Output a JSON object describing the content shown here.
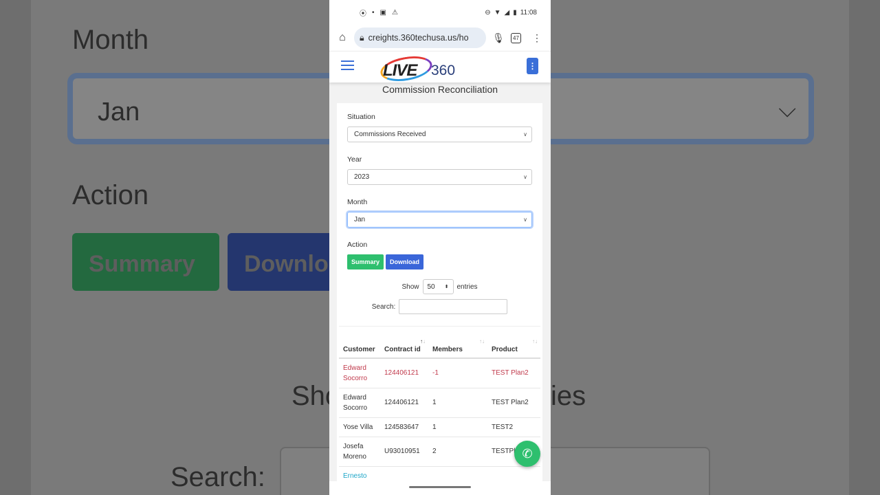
{
  "background": {
    "month_label": "Month",
    "month_value": "Jan",
    "action_label": "Action",
    "summary_label": "Summary",
    "download_label": "Downlo",
    "show_label": "Sho",
    "entries_label": "ies",
    "search_label": "Search:"
  },
  "status": {
    "time": "11:08",
    "icons": [
      "gps-icon",
      "bluetooth-icon",
      "image-icon",
      "warning-icon"
    ]
  },
  "browser": {
    "url": "creights.360techusa.us/ho",
    "tab_count": "47"
  },
  "app": {
    "logo_text": "LIVE",
    "logo_num": "360"
  },
  "page": {
    "title": "Commission Reconciliation",
    "situation_label": "Situation",
    "situation_value": "Commissions Received",
    "year_label": "Year",
    "year_value": "2023",
    "month_label": "Month",
    "month_value": "Jan",
    "action_label": "Action",
    "summary_btn": "Summary",
    "download_btn": "Download",
    "show_label": "Show",
    "show_value": "50",
    "entries_label": "entries",
    "search_label": "Search:"
  },
  "table": {
    "headers": [
      "Customer",
      "Contract id",
      "Members",
      "Product"
    ],
    "rows": [
      [
        "Edward Socorro",
        "124406121",
        "-1",
        "TEST Plan2"
      ],
      [
        "Edward Socorro",
        "124406121",
        "1",
        "TEST Plan2"
      ],
      [
        "Yose Villa",
        "124583647",
        "1",
        "TEST2"
      ],
      [
        "Josefa Moreno",
        "U93010951",
        "2",
        "TESTPl"
      ],
      [
        "Ernesto",
        "",
        "",
        ""
      ]
    ]
  },
  "colors": {
    "primary": "#3a66d9",
    "success": "#2ebf6e",
    "danger": "#c0394b",
    "link": "#1da6c8"
  }
}
